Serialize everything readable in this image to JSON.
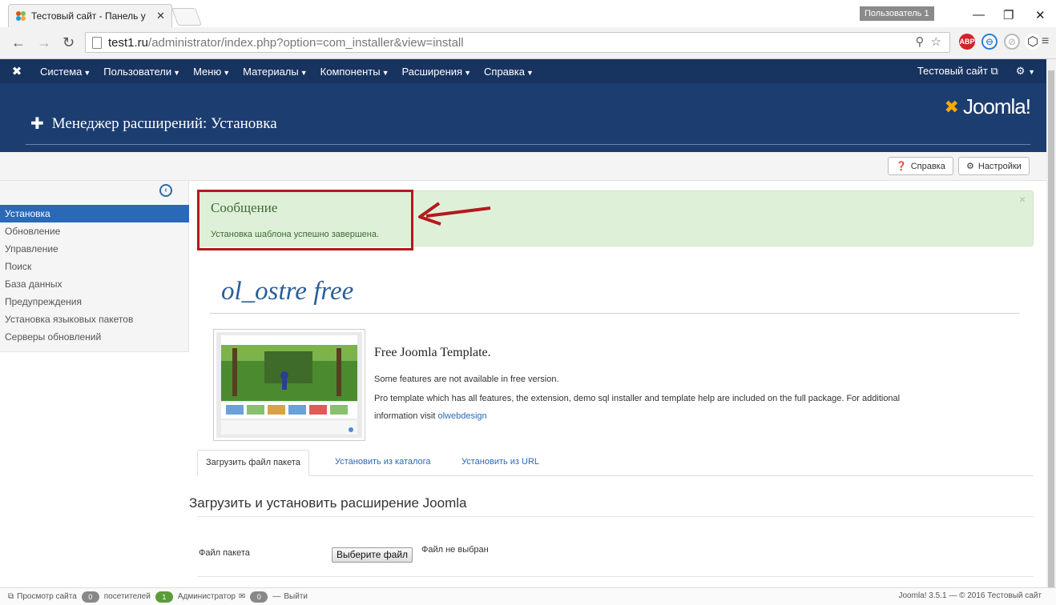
{
  "browser": {
    "tab_title": "Тестовый сайт - Панель у",
    "tab_close": "✕",
    "user_label": "Пользователь 1",
    "url_host": "test1.ru",
    "url_path": "/administrator/index.php?option=com_installer&view=install",
    "ext_abp": "ABP"
  },
  "menu": {
    "items": [
      {
        "label": "Система"
      },
      {
        "label": "Пользователи"
      },
      {
        "label": "Меню"
      },
      {
        "label": "Материалы"
      },
      {
        "label": "Компоненты"
      },
      {
        "label": "Расширения"
      },
      {
        "label": "Справка"
      }
    ],
    "site_link": "Тестовый сайт"
  },
  "header": {
    "title": "Менеджер расширений: Установка",
    "brand": "Joomla!"
  },
  "toolbar": {
    "help_label": "Справка",
    "options_label": "Настройки"
  },
  "sidebar": {
    "items": [
      {
        "label": "Установка",
        "active": true
      },
      {
        "label": "Обновление"
      },
      {
        "label": "Управление"
      },
      {
        "label": "Поиск"
      },
      {
        "label": "База данных"
      },
      {
        "label": "Предупреждения"
      },
      {
        "label": "Установка языковых пакетов"
      },
      {
        "label": "Серверы обновлений"
      }
    ]
  },
  "alert": {
    "heading": "Сообщение",
    "message": "Установка шаблона успешно завершена.",
    "close": "×"
  },
  "template": {
    "name": "ol_ostre free",
    "headline": "Free Joomla Template.",
    "p1": "Some features are not available in free version.",
    "p2": "Pro template which has all features, the extension, demo sql installer and template help are included on the full package. For additional",
    "p3_prefix": "information visit",
    "p3_link": "olwebdesign"
  },
  "tabs": [
    {
      "label": "Загрузить файл пакета",
      "active": true
    },
    {
      "label": "Установить из каталога"
    },
    {
      "label": "Установить из URL"
    }
  ],
  "upload": {
    "heading": "Загрузить и установить расширение Joomla",
    "file_label": "Файл пакета",
    "choose_button": "Выберите файл",
    "no_file": "Файл не выбран"
  },
  "footer": {
    "view_site": "Просмотр сайта",
    "visitors_count": "0",
    "visitors_label": "посетителей",
    "admins_count": "1",
    "admins_label": "Администратор",
    "messages_count": "0",
    "logout": "Выйти",
    "version": "Joomla! 3.5.1 — © 2016 Тестовый сайт"
  },
  "colors": {
    "menu_bg": "#17335f",
    "header_bg": "#1c3d6f",
    "active_sidebar": "#2a69b8",
    "alert_bg": "#dff0d8",
    "highlight_box": "#b5191d"
  }
}
